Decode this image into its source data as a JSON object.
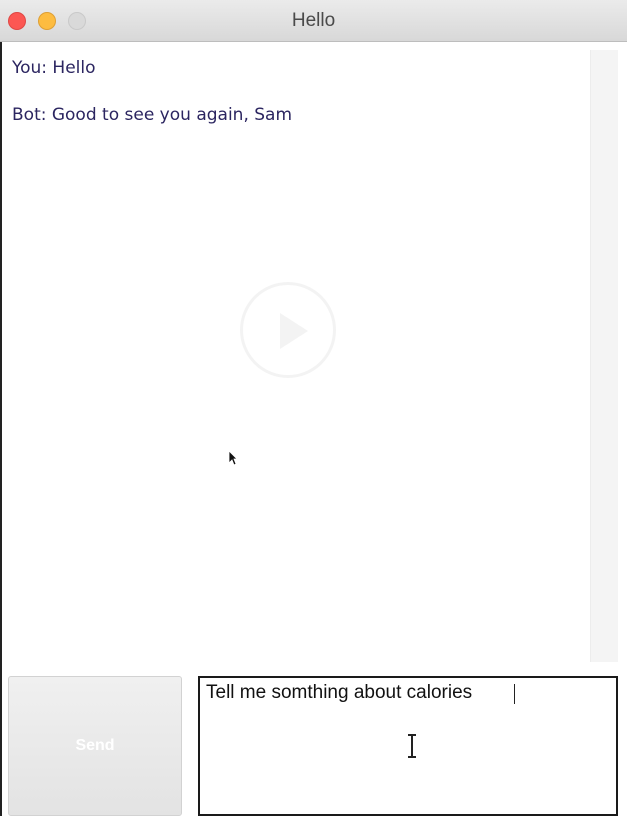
{
  "window": {
    "title": "Hello",
    "controls": [
      "close",
      "minimize",
      "zoom"
    ]
  },
  "chat": {
    "messages": [
      {
        "text": "You: Hello"
      },
      {
        "text": "Bot: Good to see you again, Sam"
      }
    ]
  },
  "composer": {
    "send_label": "Send",
    "input_value": "Tell me somthing about calories"
  },
  "icons": {
    "play_overlay": "play-icon",
    "mouse_cursor": "arrow-cursor-icon",
    "text_cursor": "ibeam-cursor-icon"
  },
  "colors": {
    "close": "#fc5753",
    "minimize": "#fdbc40",
    "zoom": "#d9d9d9",
    "chat_text": "#2b2560"
  }
}
